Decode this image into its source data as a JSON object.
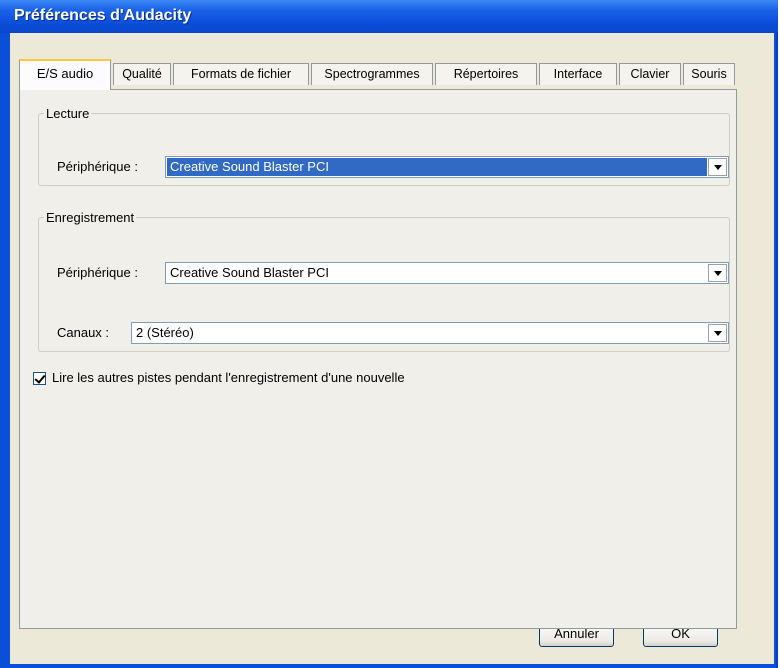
{
  "window": {
    "title": "Préférences d'Audacity"
  },
  "tabs": [
    {
      "label": "E/S audio",
      "active": true
    },
    {
      "label": "Qualité"
    },
    {
      "label": "Formats de fichier"
    },
    {
      "label": "Spectrogrammes"
    },
    {
      "label": "Répertoires"
    },
    {
      "label": "Interface"
    },
    {
      "label": "Clavier"
    },
    {
      "label": "Souris"
    }
  ],
  "playback": {
    "group_label": "Lecture",
    "device_label": "Périphérique :",
    "device_value": "Creative Sound Blaster PCI"
  },
  "recording": {
    "group_label": "Enregistrement",
    "device_label": "Périphérique :",
    "device_value": "Creative Sound Blaster PCI",
    "channels_label": "Canaux :",
    "channels_value": "2 (Stéréo)"
  },
  "options": {
    "play_other_tracks_label": "Lire les autres pistes pendant l'enregistrement d'une nouvelle",
    "play_other_tracks_checked": true
  },
  "buttons": {
    "cancel": "Annuler",
    "ok": "OK"
  },
  "colors": {
    "titlebar": "#0b4edb",
    "selection": "#316ac5",
    "dialog_bg": "#ece9d8",
    "active_tab_accent": "#ffc83c"
  }
}
